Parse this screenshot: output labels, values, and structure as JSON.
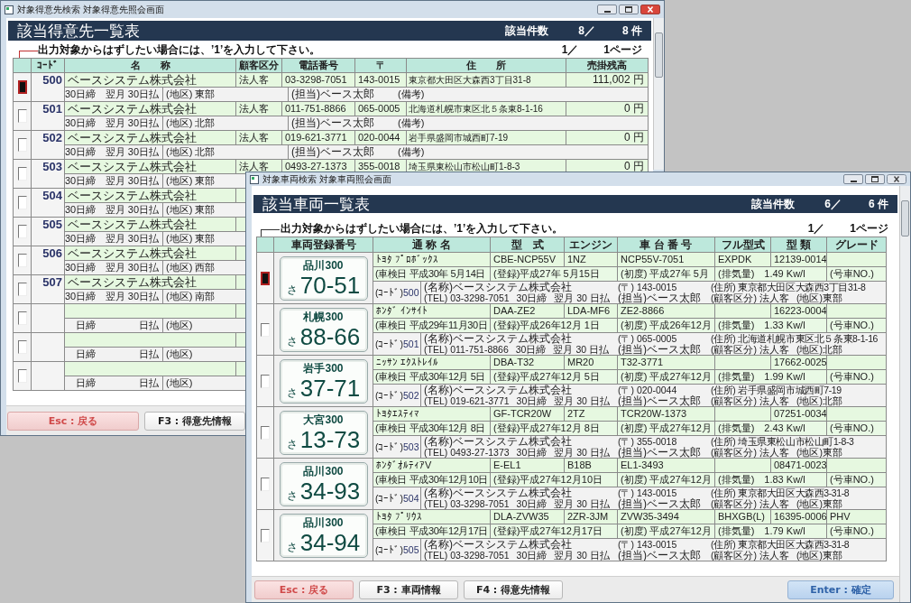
{
  "customer_window": {
    "title": "対象得意先検索 対象得意先照会画面",
    "heading": "該当得意先一覧表",
    "count_label": "該当件数",
    "count": "8／",
    "total": "8 件",
    "note": "出力対象からはずしたい場合には、’1’を入力して下さい。",
    "page": "1／",
    "pages": "1ページ",
    "columns": [
      "ｺｰﾄﾞ",
      "名　　称",
      "顧客区分",
      "電話番号",
      "〒",
      "住　　所",
      "売掛残高"
    ],
    "rows": [
      {
        "focused": true,
        "code": "500",
        "name": "ベースシステム株式会社",
        "type": "法人客",
        "phone": "03-3298-7051",
        "zip": "143-0015",
        "address": "東京都大田区大森西3丁目31-8",
        "balance": "111,002 円",
        "term": "30日締",
        "payment": "翌月 30日払",
        "area": "(地区) 東部",
        "staff": "(担当)ベース太郎",
        "memo": "(備考)"
      },
      {
        "focused": false,
        "code": "501",
        "name": "ベースシステム株式会社",
        "type": "法人客",
        "phone": "011-751-8866",
        "zip": "065-0005",
        "address": "北海道札幌市東区北５条東8-1-16",
        "balance": "0 円",
        "term": "30日締",
        "payment": "翌月 30日払",
        "area": "(地区) 北部",
        "staff": "(担当)ベース太郎",
        "memo": "(備考)"
      },
      {
        "focused": false,
        "code": "502",
        "name": "ベースシステム株式会社",
        "type": "法人客",
        "phone": "019-621-3771",
        "zip": "020-0044",
        "address": "岩手県盛岡市城西町7-19",
        "balance": "0 円",
        "term": "30日締",
        "payment": "翌月 30日払",
        "area": "(地区) 北部",
        "staff": "(担当)ベース太郎",
        "memo": "(備考)"
      },
      {
        "focused": false,
        "code": "503",
        "name": "ベースシステム株式会社",
        "type": "法人客",
        "phone": "0493-27-1373",
        "zip": "355-0018",
        "address": "埼玉県東松山市松山町1-8-3",
        "balance": "0 円",
        "term": "30日締",
        "payment": "翌月 30日払",
        "area": "(地区) 東部"
      },
      {
        "focused": false,
        "code": "504",
        "name": "ベースシステム株式会社",
        "term": "30日締",
        "payment": "翌月 30日払",
        "area": "(地区) 東部"
      },
      {
        "focused": false,
        "code": "505",
        "name": "ベースシステム株式会社",
        "term": "30日締",
        "payment": "翌月 30日払",
        "area": "(地区) 東部"
      },
      {
        "focused": false,
        "code": "506",
        "name": "ベースシステム株式会社",
        "term": "30日締",
        "payment": "翌月 30日払",
        "area": "(地区) 西部"
      },
      {
        "focused": false,
        "code": "507",
        "name": "ベースシステム株式会社",
        "term": "30日締",
        "payment": "翌月 30日払",
        "area": "(地区) 南部"
      },
      {
        "focused": false,
        "term": "日締",
        "payment": "日払",
        "area": "(地区)"
      },
      {
        "focused": false,
        "term": "日締",
        "payment": "日払",
        "area": "(地区)"
      },
      {
        "focused": false,
        "term": "日締",
        "payment": "日払",
        "area": "(地区)"
      }
    ],
    "buttons": [
      {
        "label": "Esc : 戻る",
        "kind": "cancel"
      },
      {
        "label": "F3 : 得意先情報",
        "kind": "normal"
      }
    ]
  },
  "vehicle_window": {
    "title": "対象車両検索 対象車両照会画面",
    "heading": "該当車両一覧表",
    "count_label": "該当件数",
    "count": "6／",
    "total": "6 件",
    "note": "出力対象からはずしたい場合には、’1’を入力して下さい。",
    "page": "1／",
    "pages": "1ページ",
    "columns": [
      "車両登録番号",
      "通 称 名",
      "型　式",
      "エンジン",
      "車 台 番 号",
      "フル型式",
      "型 類",
      "グレード"
    ],
    "rows": [
      {
        "focused": true,
        "plate": {
          "region": "品川300",
          "kana": "さ",
          "number": "70-51"
        },
        "name": "ﾄﾖﾀ ﾌﾟﾛﾎﾞｯｸｽ",
        "model": "CBE-NCP55V",
        "engine": "1NZ",
        "chassis": "NCP55V-7051",
        "full_model": "EXPDK",
        "type_code": "12139-0014",
        "inspection": "(車検日 平成30年 5月14日",
        "registration": "(登録)平成27年 5月15日",
        "first_registration": "(初度) 平成27年 5月",
        "displacement": "(排気量)　1.49 Kw/l",
        "car_no": "(号車NO.)",
        "code_label": "(ｺｰﾄﾞ)",
        "customer_code": "500",
        "company": "(名称)ベースシステム株式会社",
        "tel": "(TEL) 03-3298-7051",
        "term": "30日締",
        "payment": "翌月 30 日払",
        "zip": "(〒) 143-0015",
        "staff": "(担当)ベース太郎",
        "address": "(住所) 東京都大田区大森西3丁目31-8",
        "customer_type": "(顧客区分) 法人客",
        "area": "(地区)東部"
      },
      {
        "focused": false,
        "plate": {
          "region": "札幌300",
          "kana": "さ",
          "number": "88-66"
        },
        "name": "ﾎﾝﾀﾞ ｲﾝｻｲﾄ",
        "model": "DAA-ZE2",
        "engine": "LDA-MF6",
        "chassis": "ZE2-8866",
        "type_code": "16223-0004",
        "inspection": "(車検日 平成29年11月30日",
        "registration": "(登録)平成26年12月 1日",
        "first_registration": "(初度) 平成26年12月",
        "displacement": "(排気量)　1.33 Kw/l",
        "car_no": "(号車NO.)",
        "code_label": "(ｺｰﾄﾞ)",
        "customer_code": "501",
        "company": "(名称)ベースシステム株式会社",
        "tel": "(TEL) 011-751-8866",
        "term": "30日締",
        "payment": "翌月 30 日払",
        "zip": "(〒) 065-0005",
        "staff": "(担当)ベース太郎",
        "address": "(住所) 北海道札幌市東区北５条東8-1-16",
        "customer_type": "(顧客区分) 法人客",
        "area": "(地区)北部"
      },
      {
        "focused": false,
        "plate": {
          "region": "岩手300",
          "kana": "さ",
          "number": "37-71"
        },
        "name": "ﾆｯｻﾝ ｴｸｽﾄﾚｲﾙ",
        "model": "DBA-T32",
        "engine": "MR20",
        "chassis": "T32-3771",
        "type_code": "17662-0025",
        "inspection": "(車検日 平成30年12月 5日",
        "registration": "(登録)平成27年12月 5日",
        "first_registration": "(初度) 平成27年12月",
        "displacement": "(排気量)　1.99 Kw/l",
        "car_no": "(号車NO.)",
        "code_label": "(ｺｰﾄﾞ)",
        "customer_code": "502",
        "company": "(名称)ベースシステム株式会社",
        "tel": "(TEL) 019-621-3771",
        "term": "30日締",
        "payment": "翌月 30 日払",
        "zip": "(〒) 020-0044",
        "staff": "(担当)ベース太郎",
        "address": "(住所) 岩手県盛岡市城西町7-19",
        "customer_type": "(顧客区分) 法人客",
        "area": "(地区)北部"
      },
      {
        "focused": false,
        "plate": {
          "region": "大宮300",
          "kana": "さ",
          "number": "13-73"
        },
        "name": "ﾄﾖﾀｴｽﾃｨﾏ",
        "model": "GF-TCR20W",
        "engine": "2TZ",
        "chassis": "TCR20W-1373",
        "type_code": "07251-0034",
        "inspection": "(車検日 平成30年12月 8日",
        "registration": "(登録)平成27年12月 8日",
        "first_registration": "(初度) 平成27年12月",
        "displacement": "(排気量)　2.43 Kw/l",
        "car_no": "(号車NO.)",
        "code_label": "(ｺｰﾄﾞ)",
        "customer_code": "503",
        "company": "(名称)ベースシステム株式会社",
        "tel": "(TEL) 0493-27-1373",
        "term": "30日締",
        "payment": "翌月 30 日払",
        "zip": "(〒) 355-0018",
        "staff": "(担当)ベース太郎",
        "address": "(住所) 埼玉県東松山市松山町1-8-3",
        "customer_type": "(顧客区分) 法人客",
        "area": "(地区)東部"
      },
      {
        "focused": false,
        "plate": {
          "region": "品川300",
          "kana": "さ",
          "number": "34-93"
        },
        "name": "ﾎﾝﾀﾞｵﾙﾃｨｱV",
        "model": "E-EL1",
        "engine": "B18B",
        "chassis": "EL1-3493",
        "type_code": "08471-0023",
        "inspection": "(車検日 平成30年12月10日",
        "registration": "(登録)平成27年12月10日",
        "first_registration": "(初度) 平成27年12月",
        "displacement": "(排気量)　1.83 Kw/l",
        "car_no": "(号車NO.)",
        "code_label": "(ｺｰﾄﾞ)",
        "customer_code": "504",
        "company": "(名称)ベースシステム株式会社",
        "tel": "(TEL) 03-3298-7051",
        "term": "30日締",
        "payment": "翌月 30 日払",
        "zip": "(〒) 143-0015",
        "staff": "(担当)ベース太郎",
        "address": "(住所) 東京都大田区大森西3-31-8",
        "customer_type": "(顧客区分) 法人客",
        "area": "(地区)東部"
      },
      {
        "focused": false,
        "plate": {
          "region": "品川300",
          "kana": "さ",
          "number": "34-94"
        },
        "name": "ﾄﾖﾀ ﾌﾟﾘｳｽ",
        "model": "DLA-ZVW35",
        "engine": "2ZR-3JM",
        "chassis": "ZVW35-3494",
        "full_model": "BHXGB(L)",
        "type_code": "16395-0006",
        "grade": "PHV",
        "inspection": "(車検日 平成30年12月17日",
        "registration": "(登録)平成27年12月17日",
        "first_registration": "(初度) 平成27年12月",
        "displacement": "(排気量)　1.79 Kw/l",
        "car_no": "(号車NO.)",
        "code_label": "(ｺｰﾄﾞ)",
        "customer_code": "505",
        "company": "(名称)ベースシステム株式会社",
        "tel": "(TEL) 03-3298-7051",
        "term": "30日締",
        "payment": "翌月 30 日払",
        "zip": "(〒) 143-0015",
        "staff": "(担当)ベース太郎",
        "address": "(住所) 東京都大田区大森西3-31-8",
        "customer_type": "(顧客区分) 法人客",
        "area": "(地区)東部"
      }
    ],
    "buttons": [
      {
        "label": "Esc : 戻る",
        "kind": "cancel"
      },
      {
        "label": "F3 : 車両情報",
        "kind": "normal"
      },
      {
        "label": "F4 : 得意先情報",
        "kind": "normal"
      },
      {
        "label": "Enter : 確定",
        "kind": "confirm"
      }
    ]
  }
}
